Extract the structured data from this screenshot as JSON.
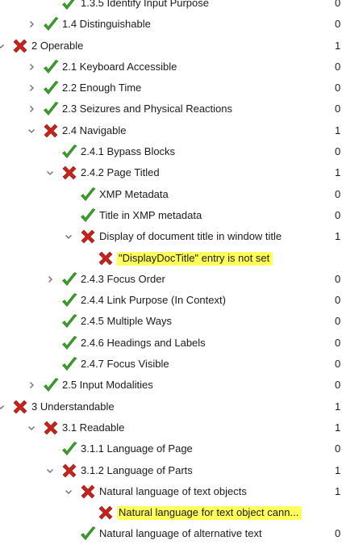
{
  "tree": {
    "rows": [
      {
        "label": "1.3.5 Identify Input Purpose",
        "count": "0",
        "status": "pass",
        "indent": 3,
        "chevron": "none"
      },
      {
        "label": "1.4 Distinguishable",
        "count": "0",
        "status": "pass",
        "indent": 2,
        "chevron": "right"
      },
      {
        "label": "2 Operable",
        "count": "1",
        "status": "fail",
        "indent": 1,
        "chevron": "down"
      },
      {
        "label": "2.1 Keyboard Accessible",
        "count": "0",
        "status": "pass",
        "indent": 2,
        "chevron": "right"
      },
      {
        "label": "2.2 Enough Time",
        "count": "0",
        "status": "pass",
        "indent": 2,
        "chevron": "right"
      },
      {
        "label": "2.3 Seizures and Physical Reactions",
        "count": "0",
        "status": "pass",
        "indent": 2,
        "chevron": "right"
      },
      {
        "label": "2.4 Navigable",
        "count": "1",
        "status": "fail",
        "indent": 2,
        "chevron": "down"
      },
      {
        "label": "2.4.1 Bypass Blocks",
        "count": "0",
        "status": "pass",
        "indent": 3,
        "chevron": "none"
      },
      {
        "label": "2.4.2 Page Titled",
        "count": "1",
        "status": "fail",
        "indent": 3,
        "chevron": "down"
      },
      {
        "label": "XMP Metadata",
        "count": "0",
        "status": "pass",
        "indent": 4,
        "chevron": "none"
      },
      {
        "label": "Title in XMP metadata",
        "count": "0",
        "status": "pass",
        "indent": 4,
        "chevron": "none"
      },
      {
        "label": "Display of document title in window title",
        "count": "1",
        "status": "fail",
        "indent": 4,
        "chevron": "down"
      },
      {
        "label": "\"DisplayDocTitle\" entry is not set",
        "count": "",
        "status": "fail",
        "indent": 5,
        "chevron": "none",
        "highlight": true
      },
      {
        "label": "2.4.3 Focus Order",
        "count": "0",
        "status": "pass",
        "indent": 3,
        "chevron": "right"
      },
      {
        "label": "2.4.4 Link Purpose (In Context)",
        "count": "0",
        "status": "pass",
        "indent": 3,
        "chevron": "none"
      },
      {
        "label": "2.4.5 Multiple Ways",
        "count": "0",
        "status": "pass",
        "indent": 3,
        "chevron": "none"
      },
      {
        "label": "2.4.6 Headings and Labels",
        "count": "0",
        "status": "pass",
        "indent": 3,
        "chevron": "none"
      },
      {
        "label": "2.4.7 Focus Visible",
        "count": "0",
        "status": "pass",
        "indent": 3,
        "chevron": "none"
      },
      {
        "label": "2.5 Input Modalities",
        "count": "0",
        "status": "pass",
        "indent": 2,
        "chevron": "right"
      },
      {
        "label": "3 Understandable",
        "count": "1",
        "status": "fail",
        "indent": 1,
        "chevron": "down"
      },
      {
        "label": "3.1 Readable",
        "count": "1",
        "status": "fail",
        "indent": 2,
        "chevron": "down"
      },
      {
        "label": "3.1.1 Language of Page",
        "count": "0",
        "status": "pass",
        "indent": 3,
        "chevron": "none"
      },
      {
        "label": "3.1.2 Language of Parts",
        "count": "1",
        "status": "fail",
        "indent": 3,
        "chevron": "down"
      },
      {
        "label": "Natural language of text objects",
        "count": "1",
        "status": "fail",
        "indent": 4,
        "chevron": "down"
      },
      {
        "label": "Natural language for text object cann...",
        "count": "",
        "status": "fail",
        "indent": 5,
        "chevron": "none",
        "highlight": true
      },
      {
        "label": "Natural language of alternative text",
        "count": "0",
        "status": "pass",
        "indent": 4,
        "chevron": "none"
      }
    ]
  },
  "colors": {
    "pass": "#3aa02a",
    "fail": "#c9221b",
    "highlight": "#ffff5a",
    "chevron": "#6a6a6a"
  }
}
